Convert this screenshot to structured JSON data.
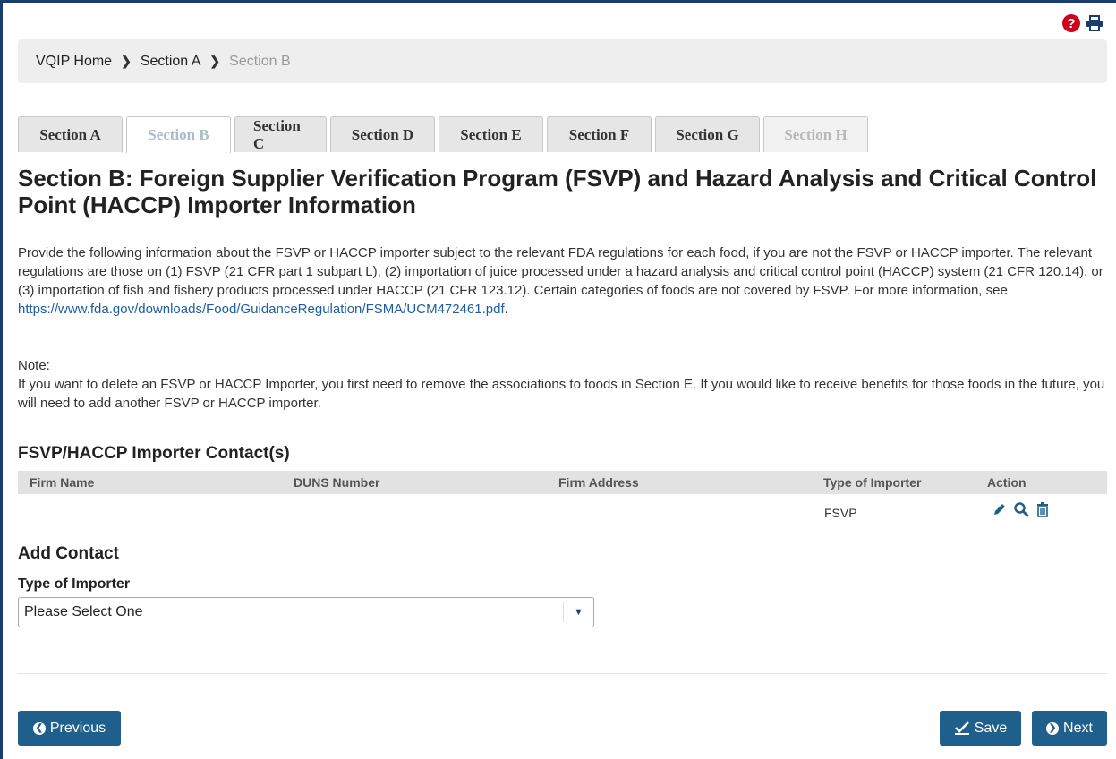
{
  "breadcrumb": {
    "items": [
      {
        "label": "VQIP Home"
      },
      {
        "label": "Section A"
      },
      {
        "label": "Section B"
      }
    ]
  },
  "tabs": [
    {
      "label": "Section A",
      "state": "normal"
    },
    {
      "label": "Section B",
      "state": "active"
    },
    {
      "label": "Section C",
      "state": "normal"
    },
    {
      "label": "Section D",
      "state": "normal"
    },
    {
      "label": "Section E",
      "state": "normal"
    },
    {
      "label": "Section F",
      "state": "normal"
    },
    {
      "label": "Section G",
      "state": "normal"
    },
    {
      "label": "Section H",
      "state": "disabled"
    }
  ],
  "page": {
    "title": "Section B: Foreign Supplier Verification Program (FSVP) and Hazard Analysis and Critical Control Point (HACCP) Importer Information",
    "intro_text": "Provide the following information about the FSVP or HACCP importer subject to the relevant FDA regulations for each food, if you are not the FSVP or HACCP importer. The relevant regulations are those on (1) FSVP (21 CFR part 1 subpart L), (2) importation of juice processed under a hazard analysis and critical control point (HACCP) system (21 CFR 120.14), or (3) importation of fish and fishery products processed under HACCP (21 CFR 123.12). Certain categories of foods are not covered by FSVP. For more information, see ",
    "intro_link": "https://www.fda.gov/downloads/Food/GuidanceRegulation/FSMA/UCM472461.pdf",
    "intro_end": ".",
    "note_label": "Note:",
    "note_text": "If you want to delete an FSVP or HACCP Importer, you first need to remove the associations to foods in Section E. If you would like to receive benefits for those foods in the future, you will need to add another FSVP or HACCP importer."
  },
  "contacts": {
    "title": "FSVP/HACCP Importer Contact(s)",
    "columns": [
      "Firm Name",
      "DUNS Number",
      "Firm Address",
      "Type of Importer",
      "Action"
    ],
    "rows": [
      {
        "firm_name": "",
        "duns": "",
        "address": "",
        "type": "FSVP"
      }
    ]
  },
  "add_contact": {
    "title": "Add Contact",
    "type_label": "Type of Importer",
    "type_value": "Please Select One"
  },
  "buttons": {
    "previous": "Previous",
    "save": "Save",
    "next": "Next"
  },
  "colors": {
    "primary": "#1f5f8b",
    "help": "#d0021b",
    "link": "#1f5d9e"
  }
}
